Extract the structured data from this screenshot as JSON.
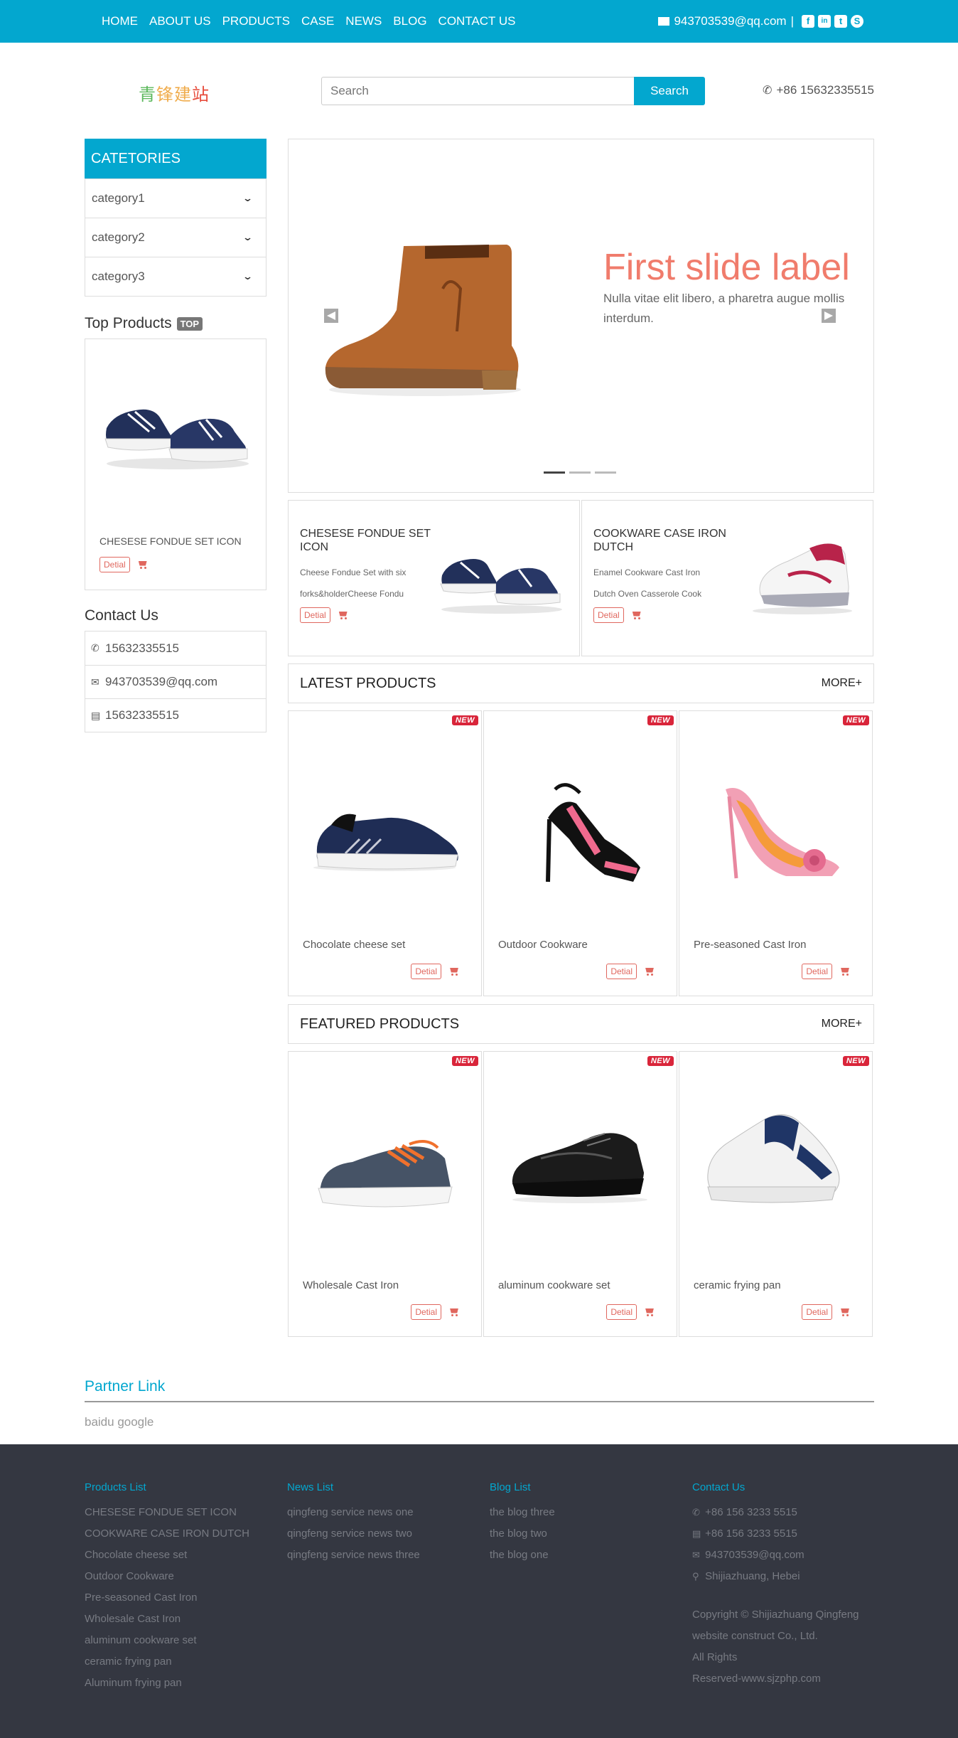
{
  "nav": {
    "items": [
      "HOME",
      "ABOUT US",
      "PRODUCTS",
      "CASE",
      "NEWS",
      "BLOG",
      "CONTACT US"
    ],
    "email": "943703539@qq.com",
    "separator": "|",
    "social": [
      {
        "icon": "facebook-icon",
        "glyph": "f"
      },
      {
        "icon": "linkedin-icon",
        "glyph": "in"
      },
      {
        "icon": "twitter-icon",
        "glyph": "t"
      },
      {
        "icon": "skype-icon",
        "glyph": "S"
      }
    ]
  },
  "header": {
    "logo_chars": [
      "青",
      "锋",
      "建",
      "站"
    ],
    "search_placeholder": "Search",
    "search_button": "Search",
    "phone": "+86 15632335515"
  },
  "sidebar": {
    "categories_title": "CATETORIES",
    "categories": [
      "category1",
      "category2",
      "category3"
    ],
    "top_products_title": "Top Products",
    "top_badge": "TOP",
    "top_product_name": "CHESESE FONDUE SET ICON",
    "contact_title": "Contact Us",
    "contact": [
      {
        "icon": "phone-icon",
        "text": "15632335515"
      },
      {
        "icon": "envelope-icon",
        "text": "943703539@qq.com"
      },
      {
        "icon": "fax-icon",
        "text": "15632335515"
      }
    ]
  },
  "carousel": {
    "label": "First slide label",
    "text": "Nulla vitae elit libero, a pharetra augue mollis interdum.",
    "active_index": 0,
    "slide_count": 3
  },
  "promos": [
    {
      "title": "CHESESE FONDUE SET ICON",
      "desc": "Cheese Fondue Set with six forks&holderCheese Fondu",
      "shoe": "sneaker-navy"
    },
    {
      "title": "COOKWARE CASE IRON DUTCH",
      "desc": "Enamel Cookware Cast Iron Dutch Oven Casserole Cook",
      "shoe": "sneaker-white"
    }
  ],
  "labels": {
    "detail": "Detial",
    "new": "NEW",
    "more": "MORE+"
  },
  "latest": {
    "title": "LATEST PRODUCTS",
    "products": [
      {
        "name": "Chocolate cheese set",
        "shoe": "runner-navy"
      },
      {
        "name": "Outdoor Cookware",
        "shoe": "heel-black-pink"
      },
      {
        "name": "Pre-seasoned Cast Iron",
        "shoe": "pump-pink"
      }
    ]
  },
  "featured": {
    "title": "FEATURED PRODUCTS",
    "products": [
      {
        "name": "Wholesale Cast Iron",
        "shoe": "canvas-slate"
      },
      {
        "name": "aluminum cookware set",
        "shoe": "oxford-black"
      },
      {
        "name": "ceramic frying pan",
        "shoe": "derby-white-navy"
      }
    ]
  },
  "partner": {
    "title": "Partner Link",
    "links": "baidu google"
  },
  "footer": {
    "products_title": "Products List",
    "products": [
      "CHESESE FONDUE SET ICON",
      "COOKWARE CASE IRON DUTCH",
      "Chocolate cheese set",
      "Outdoor Cookware",
      "Pre-seasoned Cast Iron",
      "Wholesale Cast Iron",
      "aluminum cookware set",
      "ceramic frying pan",
      "Aluminum frying pan"
    ],
    "news_title": "News List",
    "news": [
      "qingfeng service news one",
      "qingfeng service news two",
      "qingfeng service news three"
    ],
    "blog_title": "Blog List",
    "blog": [
      "the blog three",
      "the blog two",
      "the blog one"
    ],
    "contact_title": "Contact Us",
    "contact": [
      {
        "icon": "phone-icon",
        "text": "+86 156 3233 5515"
      },
      {
        "icon": "fax-icon",
        "text": "+86 156 3233 5515"
      },
      {
        "icon": "envelope-icon",
        "text": "943703539@qq.com"
      },
      {
        "icon": "map-marker-icon",
        "text": "Shijiazhuang, Hebei"
      }
    ],
    "copyright": [
      "Copyright © Shijiazhuang Qingfeng",
      "website construct Co., Ltd.",
      "All Rights",
      "Reserved-www.sjzphp.com"
    ]
  },
  "colors": {
    "brand": "#03a7cf",
    "accent_red": "#e0675e",
    "slide_label": "#f07c6c",
    "footer_bg": "#343741",
    "badge_new": "#d9253a"
  }
}
